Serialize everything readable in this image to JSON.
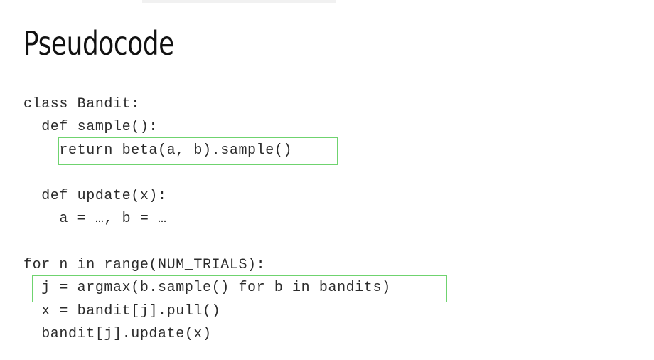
{
  "slide": {
    "title": "Pseudocode"
  },
  "code": {
    "lines": [
      "class Bandit:",
      "  def sample():",
      "    return beta(a, b).sample()",
      "  def update(x):",
      "    a = …, b = …",
      "for n in range(NUM_TRIALS):",
      "  j = argmax(b.sample() for b in bandits)",
      "  x = bandit[j].pull()",
      "  bandit[j].update(x)"
    ]
  },
  "colors": {
    "highlight_border": "#6fd36f",
    "text": "#2b2b2b",
    "title": "#111111",
    "background": "#ffffff"
  }
}
